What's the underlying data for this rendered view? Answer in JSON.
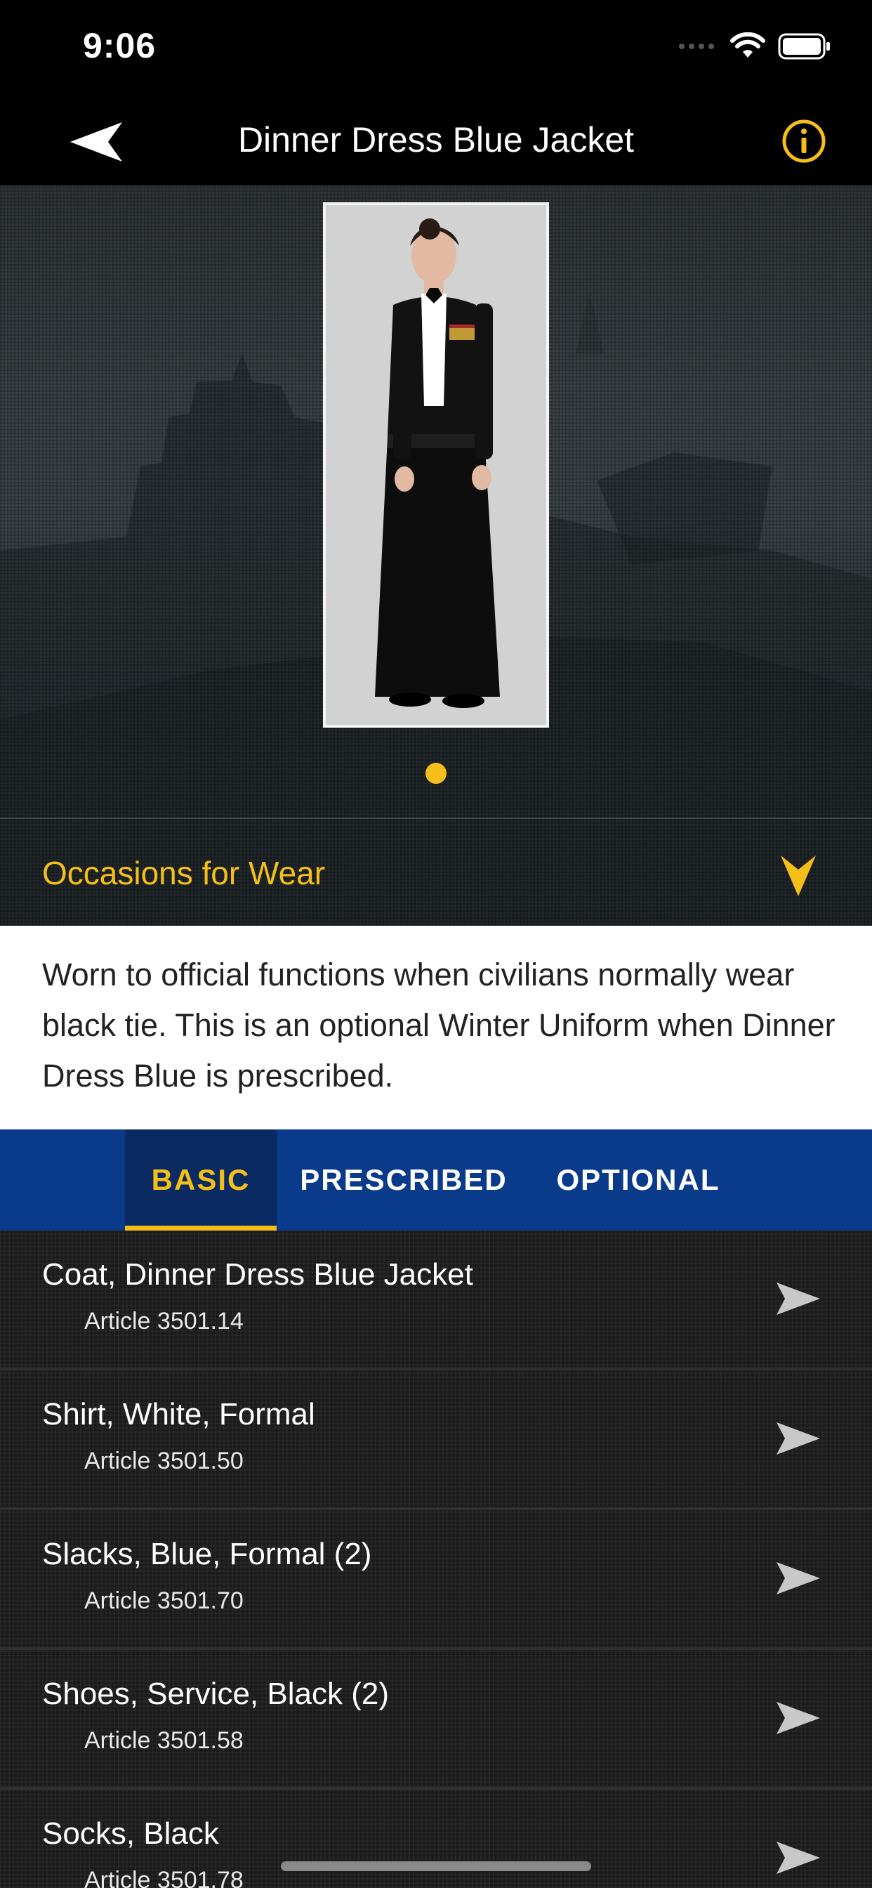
{
  "status_bar": {
    "time": "9:06"
  },
  "nav": {
    "title": "Dinner Dress Blue Jacket"
  },
  "hero": {
    "photo_alt": "Sailor in Dinner Dress Blue Jacket uniform",
    "page_count": 1,
    "current_page": 1
  },
  "occasions": {
    "title": "Occasions for Wear",
    "description": "Worn to official functions when civilians normally wear black tie. This is an optional Winter Uniform when Dinner Dress Blue is prescribed."
  },
  "tabs": [
    {
      "label": "BASIC",
      "active": true
    },
    {
      "label": "PRESCRIBED",
      "active": false
    },
    {
      "label": "OPTIONAL",
      "active": false
    }
  ],
  "items": [
    {
      "title": "Coat, Dinner Dress Blue Jacket",
      "article": "Article 3501.14"
    },
    {
      "title": "Shirt, White, Formal",
      "article": "Article 3501.50"
    },
    {
      "title": "Slacks, Blue, Formal (2)",
      "article": "Article 3501.70"
    },
    {
      "title": "Shoes, Service, Black (2)",
      "article": "Article 3501.58"
    },
    {
      "title": "Socks, Black",
      "article": "Article 3501.78"
    }
  ],
  "colors": {
    "accent": "#f5bf1a",
    "tab_bar": "#0a3a8a",
    "tab_active": "#0a2a61"
  },
  "icons": [
    "back-arrow-icon",
    "info-icon",
    "chevron-down-icon",
    "disclosure-arrow-icon",
    "wifi-icon",
    "battery-icon",
    "signal-icon"
  ]
}
